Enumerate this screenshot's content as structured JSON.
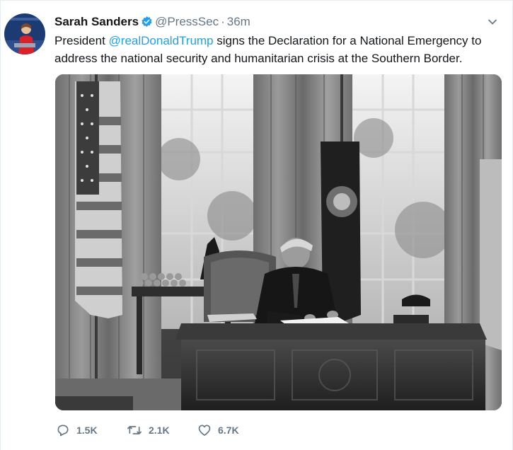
{
  "tweet": {
    "author_name": "Sarah Sanders",
    "handle": "@PressSec",
    "separator": "·",
    "time": "36m",
    "text_before": "President ",
    "mention": "@realDonaldTrump",
    "text_after": " signs the Declaration for a National Emergency to address the national security and humanitarian crisis at the Southern Border.",
    "media_alt": "President signing the declaration at the Resolute Desk in the Oval Office"
  },
  "actions": {
    "replies": "1.5K",
    "retweets": "2.1K",
    "likes": "6.7K"
  },
  "icons": {
    "verified": "verified-badge-icon",
    "menu": "chevron-down-icon",
    "reply": "reply-icon",
    "retweet": "retweet-icon",
    "like": "heart-icon"
  },
  "colors": {
    "link": "#1da1f2",
    "secondary_text": "#657786",
    "primary_text": "#14171a",
    "verified": "#1da1f2"
  }
}
